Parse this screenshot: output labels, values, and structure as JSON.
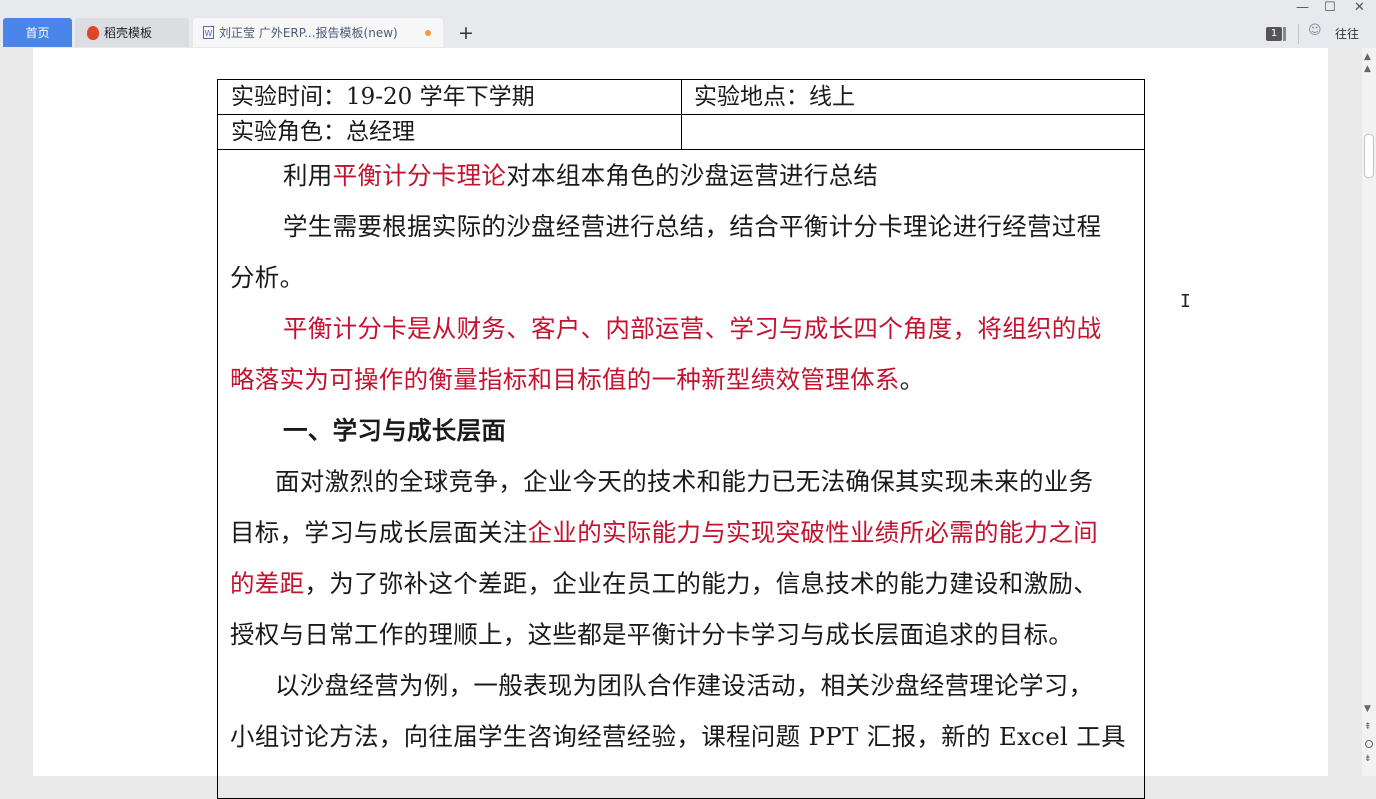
{
  "tabs": [
    {
      "label": "首页"
    },
    {
      "label": "稻壳模板",
      "icon": "daoke-icon"
    },
    {
      "label": "刘正莹 广外ERP...报告模板(new)",
      "icon": "doc-icon"
    }
  ],
  "toolbar": {
    "new_tab": "+",
    "badge_count": "1",
    "account_label": "往往",
    "minimize": "—",
    "maximize": "☐",
    "close": "✕"
  },
  "table": {
    "time": "实验时间：19-20 学年下学期",
    "place": "实验地点：线上",
    "role": "实验角色：总经理"
  },
  "content": {
    "p1_a": "利用",
    "p1_red": "平衡计分卡理论",
    "p1_b": "对本组本角色的沙盘运营进行总结",
    "p2_l1": "学生需要根据实际的沙盘经营进行总结，结合平衡计分卡理论进行经营过程",
    "p2_l2": "分析。",
    "p3_l1": "平衡计分卡是从财务、客户、内部运营、学习与成长四个角度，将组织的战",
    "p3_l2": "略落实为可操作的衡量指标和目标值的一种新型绩效管理体系",
    "p3_end": "。",
    "heading1": "一、学习与成长层面",
    "p4_l1": "面对激烈的全球竞争，企业今天的技术和能力已无法确保其实现未来的业务",
    "p4_l2a": "目标，学习与成长层面关注",
    "p4_l2red": "企业的实际能力与实现突破性业绩所必需的能力之间",
    "p4_l3red": "的差距",
    "p4_l3b": "，为了弥补这个差距，企业在员工的能力，信息技术的能力建设和激励、",
    "p4_l4": "授权与日常工作的理顺上，这些都是平衡计分卡学习与成长层面追求的目标。",
    "p5_l1": "以沙盘经营为例，一般表现为团队合作建设活动，相关沙盘经营理论学习，",
    "p5_l2": "小组讨论方法，向往届学生咨询经营经验，课程问题 PPT 汇报，新的 Excel 工具"
  },
  "colors": {
    "accent": "#4a86ea",
    "highlight_red": "#c4122f",
    "text": "#1a1a1a"
  }
}
